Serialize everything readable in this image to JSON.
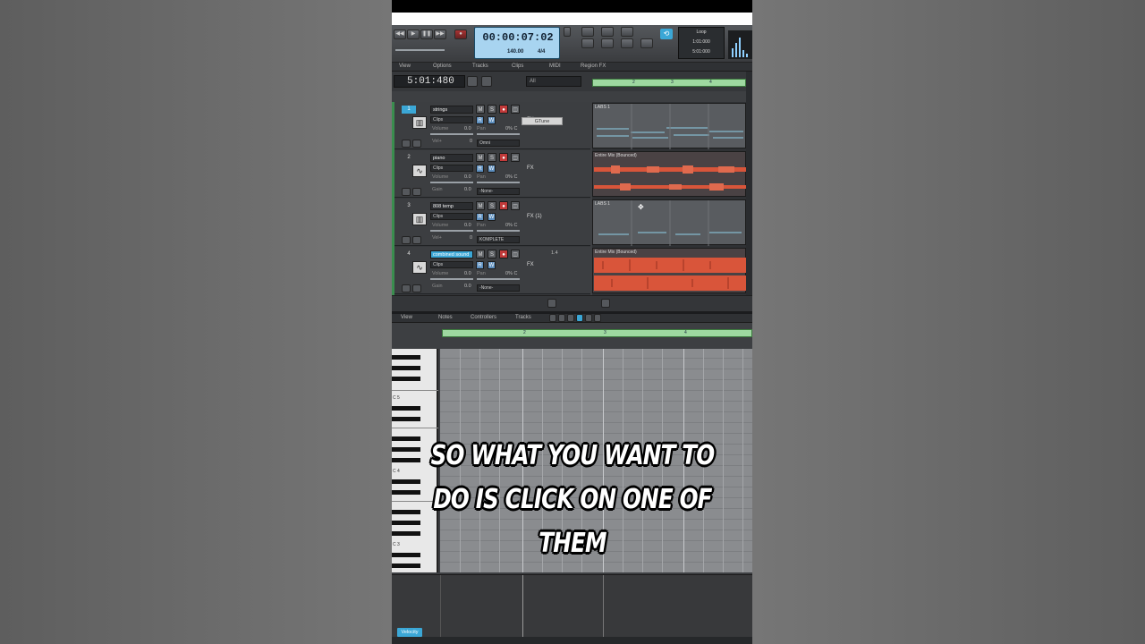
{
  "transport": {
    "clock": "00:00:07:02",
    "tempo": "140.00",
    "meter": "4/4",
    "loop_label": "Loop",
    "loop_start": "1:01:000",
    "loop_end": "5:01:000"
  },
  "track_menu": {
    "view": "View",
    "options": "Options",
    "tracks": "Tracks",
    "clips": "Clips",
    "midi": "MIDI",
    "region_fx": "Region FX"
  },
  "now_time": "5:01:480",
  "filter": "All",
  "ruler_marks": [
    "2",
    "3",
    "4"
  ],
  "tracks": [
    {
      "num": "1",
      "name": "strings",
      "mode": "Clips",
      "param1": "Volume",
      "param1_val": "0.0",
      "pan": "Pan",
      "pan_val": "0% C",
      "param2": "Vel+",
      "param2_val": "0",
      "input": "Omni",
      "fx": "FX",
      "clip": "LABS 1"
    },
    {
      "num": "2",
      "name": "piano",
      "mode": "Clips",
      "param1": "Volume",
      "param1_val": "0.0",
      "pan": "Pan",
      "pan_val": "0% C",
      "param2": "Gain",
      "param2_val": "0.0",
      "input": "-None-",
      "fx": "FX",
      "clip": "Entire Mix (Bounced)"
    },
    {
      "num": "3",
      "name": "808 temp",
      "mode": "Clips",
      "param1": "Volume",
      "param1_val": "0.0",
      "pan": "Pan",
      "pan_val": "0% C",
      "param2": "Vel+",
      "param2_val": "0",
      "input": "KOMPLETE",
      "fx": "FX (1)",
      "clip": "LABS 1"
    },
    {
      "num": "4",
      "name": "combined sound",
      "mode": "Clips",
      "param1": "Volume",
      "param1_val": "0.0",
      "pan": "Pan",
      "pan_val": "0% C",
      "param2": "Gain",
      "param2_val": "0.0",
      "input": "-None-",
      "fx": "FX",
      "clip": "Entire Mix (Bounced)",
      "meter_val": "1.4"
    }
  ],
  "fx_plugin": "GTune",
  "piano_roll_menu": {
    "view": "View",
    "notes": "Notes",
    "controllers": "Controllers",
    "tracks": "Tracks"
  },
  "pr_ruler_marks": [
    "2",
    "3",
    "4"
  ],
  "key_labels": [
    "C 5",
    "C 4",
    "C 3"
  ],
  "velocity_label": "Velocity",
  "caption": {
    "line1": "SO WHAT YOU WANT TO",
    "line2": "DO IS CLICK ON ONE OF",
    "line3": "THEM"
  },
  "colors": {
    "accent": "#3ba7d6",
    "clock_bg": "#a8d4f0",
    "ruler": "#9ed8a0",
    "audio_wave": "#d9553a",
    "midi_line": "#8fd0e8"
  }
}
